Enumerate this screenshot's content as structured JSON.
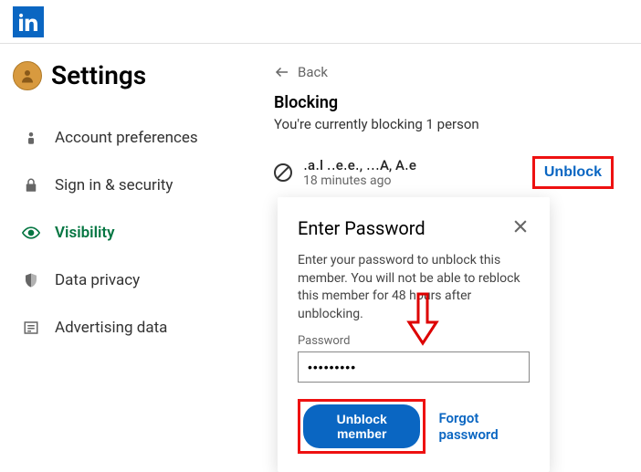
{
  "header": {
    "logo_alt": "LinkedIn"
  },
  "sidebar": {
    "title": "Settings",
    "items": [
      {
        "label": "Account preferences"
      },
      {
        "label": "Sign in & security"
      },
      {
        "label": "Visibility"
      },
      {
        "label": "Data privacy"
      },
      {
        "label": "Advertising data"
      }
    ]
  },
  "main": {
    "back_label": "Back",
    "title": "Blocking",
    "subtitle": "You're currently blocking 1 person",
    "member": {
      "name": "․a․l ․․e․e․, ․․․A, A․e",
      "time": "18 minutes ago"
    },
    "unblock_button": "Unblock"
  },
  "modal": {
    "title": "Enter Password",
    "description": "Enter your password to unblock this member. You will not be able to reblock this member for 48 hours after unblocking.",
    "password_label": "Password",
    "password_value": "•••••••••",
    "submit_label": "Unblock member",
    "forgot_label": "Forgot password"
  }
}
